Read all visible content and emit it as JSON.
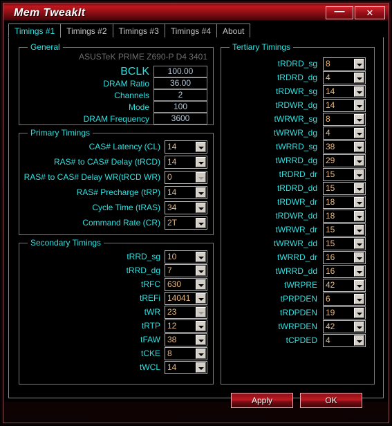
{
  "window": {
    "title": "Mem TweakIt",
    "minimize_label": "—",
    "close_label": "✕",
    "accent_color": "#c2161d",
    "label_color": "#2fe0e0",
    "value_color": "#e8b982"
  },
  "tabs": [
    {
      "label": "Timings #1",
      "active": true
    },
    {
      "label": "Timings #2",
      "active": false
    },
    {
      "label": "Timings #3",
      "active": false
    },
    {
      "label": "Timings #4",
      "active": false
    },
    {
      "label": "About",
      "active": false
    }
  ],
  "general": {
    "title": "General",
    "motherboard": "ASUSTeK PRIME Z690-P D4 3401",
    "rows": [
      {
        "label": "BCLK",
        "value": "100.00"
      },
      {
        "label": "DRAM Ratio",
        "value": "36.00"
      },
      {
        "label": "Channels",
        "value": "2"
      },
      {
        "label": "Mode",
        "value": "100"
      },
      {
        "label": "DRAM Frequency",
        "value": "3600"
      }
    ]
  },
  "primary": {
    "title": "Primary Timings",
    "rows": [
      {
        "label": "CAS# Latency (CL)",
        "value": "14",
        "disabled": false
      },
      {
        "label": "RAS# to CAS# Delay (tRCD)",
        "value": "14",
        "disabled": false
      },
      {
        "label": "RAS# to CAS# Delay WR(tRCD WR)",
        "value": "0",
        "disabled": true
      },
      {
        "label": "RAS# Precharge (tRP)",
        "value": "14",
        "disabled": false
      },
      {
        "label": "Cycle Time (tRAS)",
        "value": "34",
        "disabled": false
      },
      {
        "label": "Command Rate (CR)",
        "value": "2T",
        "disabled": false
      }
    ]
  },
  "secondary": {
    "title": "Secondary Timings",
    "rows": [
      {
        "label": "tRRD_sg",
        "value": "10",
        "disabled": false
      },
      {
        "label": "tRRD_dg",
        "value": "7",
        "disabled": false
      },
      {
        "label": "tRFC",
        "value": "630",
        "disabled": false
      },
      {
        "label": "tREFi",
        "value": "14041",
        "disabled": false
      },
      {
        "label": "tWR",
        "value": "23",
        "disabled": true
      },
      {
        "label": "tRTP",
        "value": "12",
        "disabled": false
      },
      {
        "label": "tFAW",
        "value": "38",
        "disabled": false
      },
      {
        "label": "tCKE",
        "value": "8",
        "disabled": false
      },
      {
        "label": "tWCL",
        "value": "14",
        "disabled": false
      }
    ]
  },
  "tertiary": {
    "title": "Tertiary Timings",
    "rows": [
      {
        "label": "tRDRD_sg",
        "value": "8",
        "disabled": false
      },
      {
        "label": "tRDRD_dg",
        "value": "4",
        "disabled": false
      },
      {
        "label": "tRDWR_sg",
        "value": "14",
        "disabled": false
      },
      {
        "label": "tRDWR_dg",
        "value": "14",
        "disabled": false
      },
      {
        "label": "tWRWR_sg",
        "value": "8",
        "disabled": false
      },
      {
        "label": "tWRWR_dg",
        "value": "4",
        "disabled": false
      },
      {
        "label": "tWRRD_sg",
        "value": "38",
        "disabled": false
      },
      {
        "label": "tWRRD_dg",
        "value": "29",
        "disabled": false
      },
      {
        "label": "tRDRD_dr",
        "value": "15",
        "disabled": false
      },
      {
        "label": "tRDRD_dd",
        "value": "15",
        "disabled": false
      },
      {
        "label": "tRDWR_dr",
        "value": "18",
        "disabled": false
      },
      {
        "label": "tRDWR_dd",
        "value": "18",
        "disabled": false
      },
      {
        "label": "tWRWR_dr",
        "value": "15",
        "disabled": false
      },
      {
        "label": "tWRWR_dd",
        "value": "15",
        "disabled": false
      },
      {
        "label": "tWRRD_dr",
        "value": "16",
        "disabled": false
      },
      {
        "label": "tWRRD_dd",
        "value": "16",
        "disabled": false
      },
      {
        "label": "tWRPRE",
        "value": "42",
        "disabled": false
      },
      {
        "label": "tPRPDEN",
        "value": "6",
        "disabled": false
      },
      {
        "label": "tRDPDEN",
        "value": "19",
        "disabled": false
      },
      {
        "label": "tWRPDEN",
        "value": "42",
        "disabled": false
      },
      {
        "label": "tCPDED",
        "value": "4",
        "disabled": false
      }
    ]
  },
  "footer": {
    "apply_label": "Apply",
    "ok_label": "OK"
  }
}
